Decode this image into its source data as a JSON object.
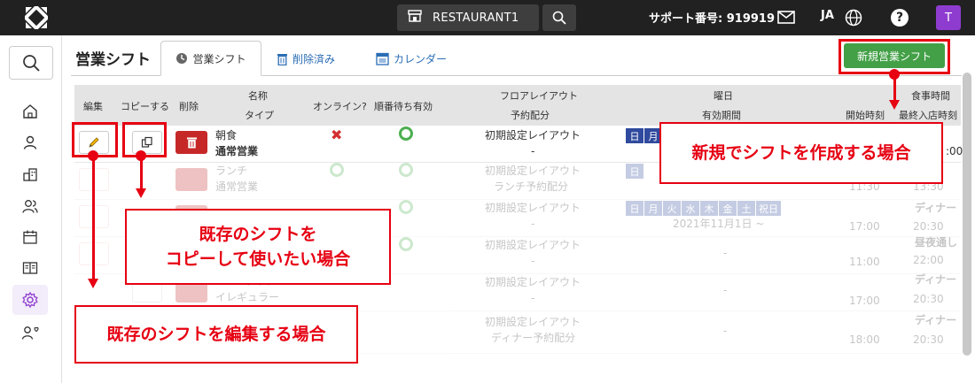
{
  "topbar": {
    "store_name": "RESTAURANT1",
    "support_label": "サポート番号: 919919",
    "language": "JA",
    "help": "?",
    "avatar_letter": "T"
  },
  "page": {
    "title": "営業シフト",
    "tabs": [
      {
        "label": "営業シフト"
      },
      {
        "label": "削除済み"
      },
      {
        "label": "カレンダー"
      }
    ],
    "new_button": "新規営業シフト"
  },
  "table": {
    "headers": {
      "edit": "編集",
      "copy": "コピーする",
      "delete": "削除",
      "name": "名称",
      "type": "タイプ",
      "online": "オンライン?",
      "queue": "順番待ち有効",
      "floor": "フロアレイアウト",
      "reservation": "予約配分",
      "weekday": "曜日",
      "period": "有効期間",
      "meal": "食事時間",
      "start": "開始時刻",
      "last": "最終入店時刻"
    },
    "rows": [
      {
        "name": "朝食",
        "type": "通常営業",
        "floor": "初期設定レイアウト",
        "alloc": "-",
        "days": [
          "日",
          "月"
        ],
        "meal": "",
        "time1": "",
        "time2": ":00"
      },
      {
        "name": "ランチ",
        "type": "通常営業",
        "floor": "初期設定レイアウト",
        "alloc": "ランチ予約配分",
        "days": [
          "日"
        ],
        "meal": "",
        "time1": "11:30",
        "time2": "13:30"
      },
      {
        "name": "",
        "type": "",
        "floor": "初期設定レイアウト",
        "alloc": "-",
        "days": [
          "日",
          "月",
          "火",
          "水",
          "木",
          "金",
          "土",
          "祝日"
        ],
        "period": "2021年11月1日 ~",
        "meal": "ディナー",
        "time1": "17:00",
        "time2": "20:30"
      },
      {
        "name": "",
        "type": "",
        "floor": "初期設定レイアウト",
        "alloc": "-",
        "days": [],
        "period": "-",
        "meal": "昼夜通し",
        "time1": "11:00",
        "time2": "22:00"
      },
      {
        "name": "Xmasディナー",
        "type": "イレギュラー",
        "floor": "初期設定レイアウト",
        "alloc": "-",
        "days": [],
        "period": "-",
        "meal": "ディナー",
        "time1": "17:00",
        "time2": "20:30"
      },
      {
        "name": "",
        "type": "",
        "floor": "初期設定レイアウト",
        "alloc": "ディナー予約配分",
        "days": [],
        "period": "-",
        "meal": "ディナー",
        "time1": "18:00",
        "time2": "20:30"
      }
    ]
  },
  "annotations": {
    "new": "新規でシフトを作成する場合",
    "copy_line1": "既存のシフトを",
    "copy_line2": "コピーして使いたい場合",
    "edit": "既存のシフトを編集する場合"
  },
  "colors": {
    "annotation": "#e60012",
    "primary_button": "#43a047",
    "delete_button": "#c62828",
    "day_badge": "#2f4a9e",
    "avatar": "#8e3ccf"
  }
}
